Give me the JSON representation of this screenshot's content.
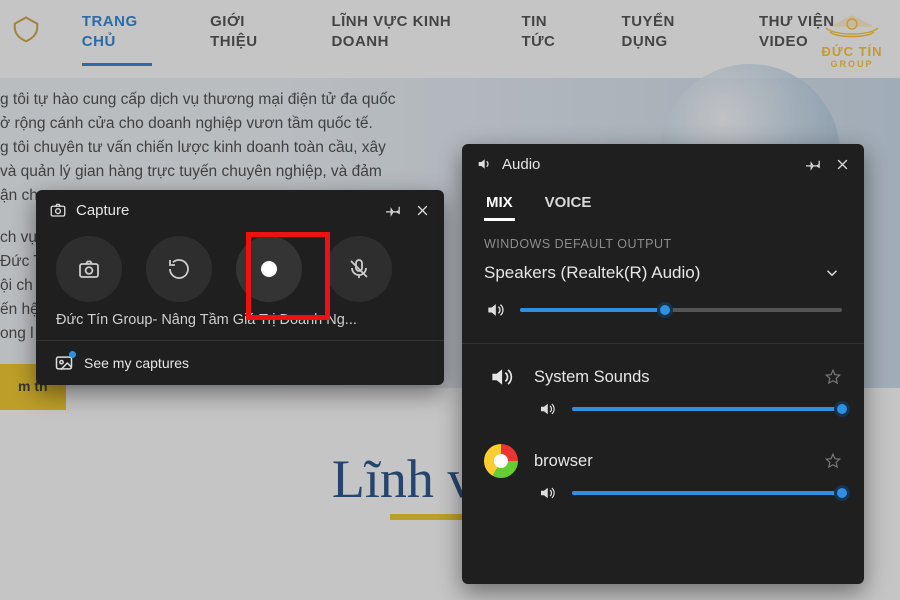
{
  "nav": {
    "items": [
      {
        "label": "TRANG CHỦ",
        "active": true
      },
      {
        "label": "GIỚI THIỆU"
      },
      {
        "label": "LĨNH VỰC KINH DOANH"
      },
      {
        "label": "TIN TỨC"
      },
      {
        "label": "TUYỂN DỤNG"
      },
      {
        "label": "THƯ VIỆN VIDEO"
      }
    ]
  },
  "watermark": {
    "line1": "ĐỨC TÍN",
    "line2": "GROUP"
  },
  "hero": {
    "p1": "g tôi tự hào cung cấp dịch vụ thương mại điện tử đa quốc",
    "p2": "ở rộng cánh cửa cho doanh nghiệp vươn tầm quốc tế.",
    "p3": "g tôi chuyên tư vấn chiến lược kinh doanh toàn cầu, xây",
    "p4": "và quản lý gian hàng trực tuyến chuyên nghiệp, và đảm",
    "p5": "ận ch",
    "p6": "ch vụ",
    "p7": "Đức T",
    "p8": "ội ch",
    "p9": "ến hệ",
    "p10": "ong l",
    "cta": "m th"
  },
  "headline": "Lĩnh vực k",
  "capture": {
    "title": "Capture",
    "window_title": "Đức Tín Group- Nâng Tầm Giá Trị Doanh Ng...",
    "see_my": "See my captures"
  },
  "audio": {
    "title": "Audio",
    "tabs": {
      "mix": "MIX",
      "voice": "VOICE"
    },
    "section": "WINDOWS DEFAULT OUTPUT",
    "device": "Speakers (Realtek(R) Audio)",
    "master_volume_pct": 45,
    "apps": [
      {
        "name": "System Sounds",
        "icon": "sys",
        "volume_pct": 100
      },
      {
        "name": "browser",
        "icon": "browser",
        "volume_pct": 100
      }
    ]
  }
}
